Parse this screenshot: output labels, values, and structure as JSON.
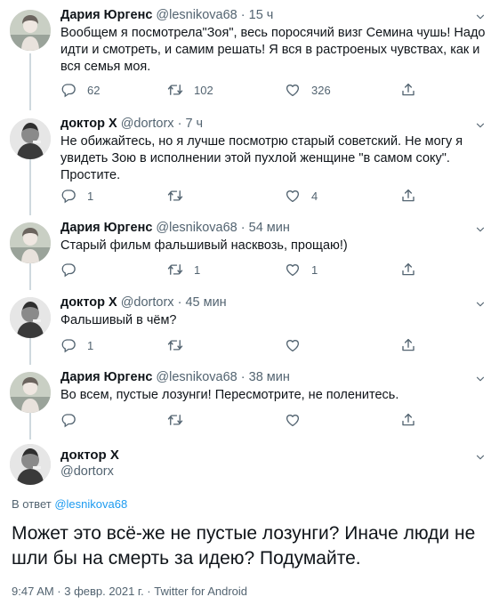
{
  "colors": {
    "text": "#0f1419",
    "muted": "#536471",
    "link": "#1d9bf0",
    "line": "#cfd9de"
  },
  "tweets": [
    {
      "name": "Дария Юргенс",
      "handle": "@lesnikova68",
      "dot": "·",
      "time": "15 ч",
      "text": "Вообщем я посмотрела\"Зоя\", весь поросячий визг Семина чушь! Надо идти и смотреть, и самим решать! Я вся в растроеных чувствах, как и вся семья моя.",
      "replies": "62",
      "retweets": "102",
      "likes": "326",
      "avatar": "woman-avatar"
    },
    {
      "name": "доктор Х",
      "handle": "@dortorx",
      "dot": "·",
      "time": "7 ч",
      "text": "Не обижайтесь, но я лучше посмотрю старый советский. Не могу я увидеть Зою в исполнении этой пухлой женщине \"в самом соку\". Простите.",
      "replies": "1",
      "retweets": "",
      "likes": "4",
      "avatar": "man-avatar"
    },
    {
      "name": "Дария Юргенс",
      "handle": "@lesnikova68",
      "dot": "·",
      "time": "54 мин",
      "text": "Старый фильм фальшивый насквозь, прощаю!)",
      "replies": "",
      "retweets": "1",
      "likes": "1",
      "avatar": "woman-avatar"
    },
    {
      "name": "доктор Х",
      "handle": "@dortorx",
      "dot": "·",
      "time": "45 мин",
      "text": "Фальшивый в чём?",
      "replies": "1",
      "retweets": "",
      "likes": "",
      "avatar": "man-avatar"
    },
    {
      "name": "Дария Юргенс",
      "handle": "@lesnikova68",
      "dot": "·",
      "time": "38 мин",
      "text": "Во всем, пустые лозунги! Пересмотрите, не поленитесь.",
      "replies": "",
      "retweets": "",
      "likes": "",
      "avatar": "woman-avatar"
    }
  ],
  "main": {
    "name": "доктор Х",
    "handle": "@dortorx",
    "reply_prefix": "В ответ",
    "reply_mention": "@lesnikova68",
    "text": "Может это всё-же не пустые лозунги? Иначе люди не шли бы на смерть за идею? Подумайте.",
    "meta": "9:47 AM · 3 февр. 2021 г. · Twitter for Android"
  }
}
